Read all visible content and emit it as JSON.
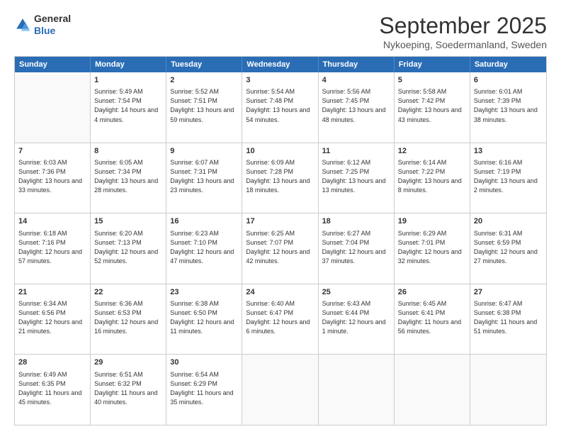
{
  "logo": {
    "line1": "General",
    "line2": "Blue"
  },
  "title": "September 2025",
  "location": "Nykoeping, Soedermanland, Sweden",
  "weekdays": [
    "Sunday",
    "Monday",
    "Tuesday",
    "Wednesday",
    "Thursday",
    "Friday",
    "Saturday"
  ],
  "weeks": [
    [
      {
        "day": "",
        "empty": true
      },
      {
        "day": "1",
        "sunrise": "5:49 AM",
        "sunset": "7:54 PM",
        "daylight": "14 hours and 4 minutes."
      },
      {
        "day": "2",
        "sunrise": "5:52 AM",
        "sunset": "7:51 PM",
        "daylight": "13 hours and 59 minutes."
      },
      {
        "day": "3",
        "sunrise": "5:54 AM",
        "sunset": "7:48 PM",
        "daylight": "13 hours and 54 minutes."
      },
      {
        "day": "4",
        "sunrise": "5:56 AM",
        "sunset": "7:45 PM",
        "daylight": "13 hours and 48 minutes."
      },
      {
        "day": "5",
        "sunrise": "5:58 AM",
        "sunset": "7:42 PM",
        "daylight": "13 hours and 43 minutes."
      },
      {
        "day": "6",
        "sunrise": "6:01 AM",
        "sunset": "7:39 PM",
        "daylight": "13 hours and 38 minutes."
      }
    ],
    [
      {
        "day": "7",
        "sunrise": "6:03 AM",
        "sunset": "7:36 PM",
        "daylight": "13 hours and 33 minutes."
      },
      {
        "day": "8",
        "sunrise": "6:05 AM",
        "sunset": "7:34 PM",
        "daylight": "13 hours and 28 minutes."
      },
      {
        "day": "9",
        "sunrise": "6:07 AM",
        "sunset": "7:31 PM",
        "daylight": "13 hours and 23 minutes."
      },
      {
        "day": "10",
        "sunrise": "6:09 AM",
        "sunset": "7:28 PM",
        "daylight": "13 hours and 18 minutes."
      },
      {
        "day": "11",
        "sunrise": "6:12 AM",
        "sunset": "7:25 PM",
        "daylight": "13 hours and 13 minutes."
      },
      {
        "day": "12",
        "sunrise": "6:14 AM",
        "sunset": "7:22 PM",
        "daylight": "13 hours and 8 minutes."
      },
      {
        "day": "13",
        "sunrise": "6:16 AM",
        "sunset": "7:19 PM",
        "daylight": "13 hours and 2 minutes."
      }
    ],
    [
      {
        "day": "14",
        "sunrise": "6:18 AM",
        "sunset": "7:16 PM",
        "daylight": "12 hours and 57 minutes."
      },
      {
        "day": "15",
        "sunrise": "6:20 AM",
        "sunset": "7:13 PM",
        "daylight": "12 hours and 52 minutes."
      },
      {
        "day": "16",
        "sunrise": "6:23 AM",
        "sunset": "7:10 PM",
        "daylight": "12 hours and 47 minutes."
      },
      {
        "day": "17",
        "sunrise": "6:25 AM",
        "sunset": "7:07 PM",
        "daylight": "12 hours and 42 minutes."
      },
      {
        "day": "18",
        "sunrise": "6:27 AM",
        "sunset": "7:04 PM",
        "daylight": "12 hours and 37 minutes."
      },
      {
        "day": "19",
        "sunrise": "6:29 AM",
        "sunset": "7:01 PM",
        "daylight": "12 hours and 32 minutes."
      },
      {
        "day": "20",
        "sunrise": "6:31 AM",
        "sunset": "6:59 PM",
        "daylight": "12 hours and 27 minutes."
      }
    ],
    [
      {
        "day": "21",
        "sunrise": "6:34 AM",
        "sunset": "6:56 PM",
        "daylight": "12 hours and 21 minutes."
      },
      {
        "day": "22",
        "sunrise": "6:36 AM",
        "sunset": "6:53 PM",
        "daylight": "12 hours and 16 minutes."
      },
      {
        "day": "23",
        "sunrise": "6:38 AM",
        "sunset": "6:50 PM",
        "daylight": "12 hours and 11 minutes."
      },
      {
        "day": "24",
        "sunrise": "6:40 AM",
        "sunset": "6:47 PM",
        "daylight": "12 hours and 6 minutes."
      },
      {
        "day": "25",
        "sunrise": "6:43 AM",
        "sunset": "6:44 PM",
        "daylight": "12 hours and 1 minute."
      },
      {
        "day": "26",
        "sunrise": "6:45 AM",
        "sunset": "6:41 PM",
        "daylight": "11 hours and 56 minutes."
      },
      {
        "day": "27",
        "sunrise": "6:47 AM",
        "sunset": "6:38 PM",
        "daylight": "11 hours and 51 minutes."
      }
    ],
    [
      {
        "day": "28",
        "sunrise": "6:49 AM",
        "sunset": "6:35 PM",
        "daylight": "11 hours and 45 minutes."
      },
      {
        "day": "29",
        "sunrise": "6:51 AM",
        "sunset": "6:32 PM",
        "daylight": "11 hours and 40 minutes."
      },
      {
        "day": "30",
        "sunrise": "6:54 AM",
        "sunset": "6:29 PM",
        "daylight": "11 hours and 35 minutes."
      },
      {
        "day": "",
        "empty": true
      },
      {
        "day": "",
        "empty": true
      },
      {
        "day": "",
        "empty": true
      },
      {
        "day": "",
        "empty": true
      }
    ]
  ]
}
